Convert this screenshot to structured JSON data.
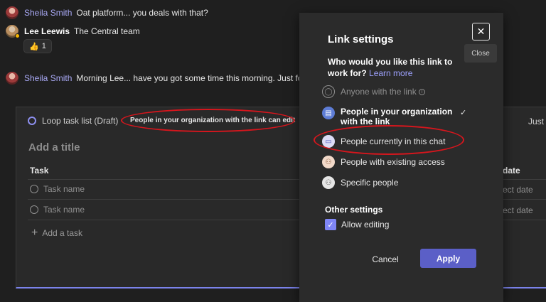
{
  "chat": {
    "messages": [
      {
        "author": "Sheila Smith",
        "text": "Oat platform... you deals with that?"
      },
      {
        "author": "Lee Leewis",
        "text": "The Central team"
      },
      {
        "author": "Sheila Smith",
        "text": "Morning Lee... have you got some time this morning. Just follow"
      }
    ],
    "reaction": {
      "emoji": "👍",
      "count": "1"
    }
  },
  "loop": {
    "title": "Loop task list (Draft)",
    "share_text": "People in your organization with the link can edit",
    "right_text": "Just r",
    "add_title_placeholder": "Add a title",
    "col_task": "Task",
    "col_date": "date",
    "rows": [
      {
        "task": "Task name",
        "date": "ect date"
      },
      {
        "task": "Task name",
        "date": "ect date"
      }
    ],
    "add_task": "Add a task"
  },
  "dialog": {
    "title": "Link settings",
    "close_tooltip": "Close",
    "question": "Who would you like this link to work for?",
    "learn_more": "Learn more",
    "options": [
      {
        "label": "Anyone with the link",
        "icon": "globe-icon"
      },
      {
        "label": "People in your organization with the link",
        "icon": "organization-icon"
      },
      {
        "label": "People currently in this chat",
        "icon": "chat-icon"
      },
      {
        "label": "People with existing access",
        "icon": "existing-access-icon"
      },
      {
        "label": "Specific people",
        "icon": "people-icon"
      }
    ],
    "selected_option": "People in your organization with the link",
    "other_settings_title": "Other settings",
    "allow_editing_label": "Allow editing",
    "allow_editing_checked": true,
    "cancel_label": "Cancel",
    "apply_label": "Apply"
  },
  "colors": {
    "background": "#1f1f1f",
    "accent": "#5b5fc7",
    "annotation": "#d6161d",
    "author_name": "#a9a9f5"
  }
}
